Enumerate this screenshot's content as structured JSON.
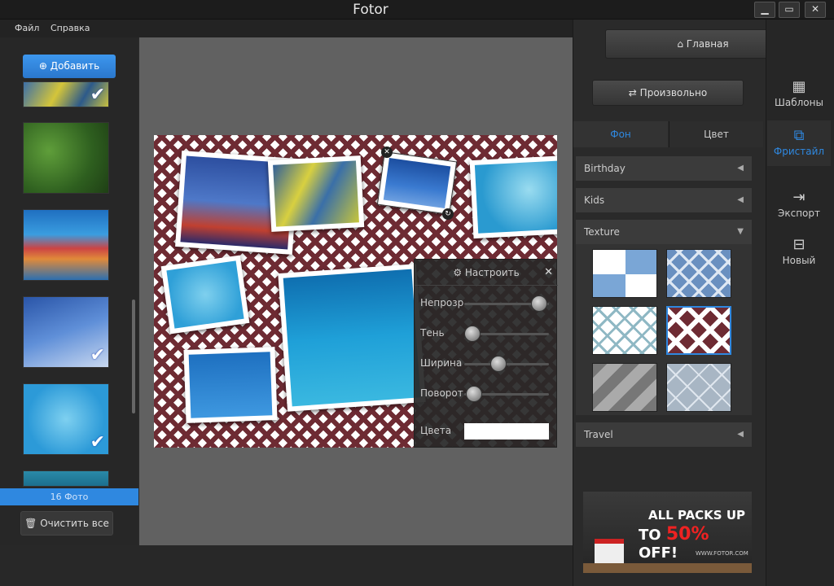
{
  "app": {
    "title": "Fotor",
    "win_min": "▁",
    "win_max": "▭",
    "win_close": "✕"
  },
  "menu": {
    "file": "Файл",
    "help": "Справка"
  },
  "left": {
    "add_label": "Добавить",
    "photo_count": "16 Фото",
    "clear_label": "Очистить все"
  },
  "adjust": {
    "title": "Настроить",
    "close": "✕",
    "sliders": [
      {
        "label": "Непрозр",
        "value": 0.88
      },
      {
        "label": "Тень",
        "value": 0.1
      },
      {
        "label": "Ширина",
        "value": 0.4
      },
      {
        "label": "Поворот",
        "value": 0.12
      }
    ],
    "colors_label": "Цвета",
    "color": "#ffffff"
  },
  "right": {
    "home_label": "Главная",
    "random_label": "Произвольно",
    "tabs": {
      "bg": "Фон",
      "color": "Цвет"
    },
    "categories": {
      "birthday": "Birthday",
      "kids": "Kids",
      "texture": "Texture",
      "travel": "Travel"
    }
  },
  "ad": {
    "line1": "ALL PACKS UP",
    "line2_a": "TO ",
    "line2_b": "50%",
    "line2_c": " OFF!",
    "url": "WWW.FOTOR.COM"
  },
  "rail": {
    "templates": "Шаблоны",
    "freestyle": "Фристайл",
    "export": "Экспорт",
    "new": "Новый"
  },
  "colors": {
    "accent": "#2f88e0",
    "pattern": "#6e2b33"
  }
}
